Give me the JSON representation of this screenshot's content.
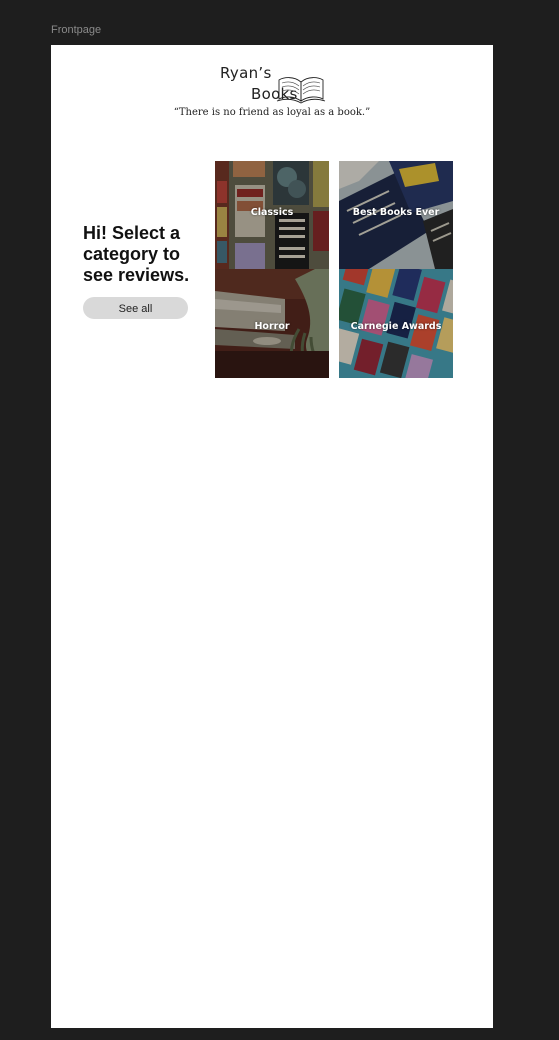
{
  "frame": {
    "label": "Frontpage"
  },
  "header": {
    "logo_line1": "Ryan’s",
    "logo_line2": "Books",
    "logo_icon": "open-book-icon",
    "tagline": "“There is no friend as loyal as a book.”"
  },
  "hero": {
    "headline": "Hi! Select a category to see reviews.",
    "see_all_label": "See all"
  },
  "categories": [
    {
      "label": "Classics"
    },
    {
      "label": "Best Books Ever"
    },
    {
      "label": "Horror"
    },
    {
      "label": "Carnegie Awards"
    }
  ],
  "colors": {
    "canvas_bg": "#1e1e1e",
    "artboard_bg": "#ffffff",
    "button_bg": "#d9d9d9"
  }
}
